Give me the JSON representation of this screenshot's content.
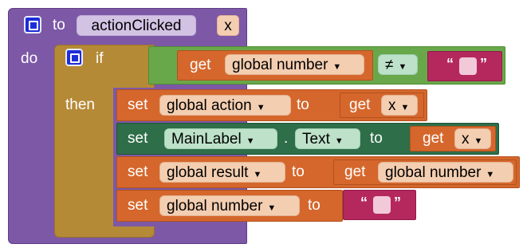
{
  "procedure": {
    "keyword_to": "to",
    "name": "actionClicked",
    "close_label": "x",
    "keyword_do": "do"
  },
  "if_block": {
    "keyword_if": "if",
    "keyword_then": "then"
  },
  "condition": {
    "get_label": "get",
    "variable": "global number",
    "operator": "≠",
    "text_open_quote": "“",
    "text_close_quote": "”"
  },
  "statements": [
    {
      "set_label": "set",
      "target": "global action",
      "to_label": "to",
      "get_label": "get",
      "value": "x"
    },
    {
      "set_label": "set",
      "component": "MainLabel",
      "dot": ".",
      "property": "Text",
      "to_label": "to",
      "get_label": "get",
      "value": "x"
    },
    {
      "set_label": "set",
      "target": "global result",
      "to_label": "to",
      "get_label": "get",
      "value": "global number"
    },
    {
      "set_label": "set",
      "target": "global number",
      "to_label": "to",
      "text_open_quote": "“",
      "text_close_quote": "”"
    }
  ],
  "colors": {
    "procedure": "#7d58a6",
    "control": "#b58a37",
    "logic": "#69a84a",
    "variables": "#d5672c",
    "component": "#2e6e48",
    "text": "#b4285e",
    "mutator": "#1d2dd8"
  },
  "icons": {
    "mutator": "gear-mutator-icon",
    "dropdown": "dropdown-arrow-icon"
  }
}
